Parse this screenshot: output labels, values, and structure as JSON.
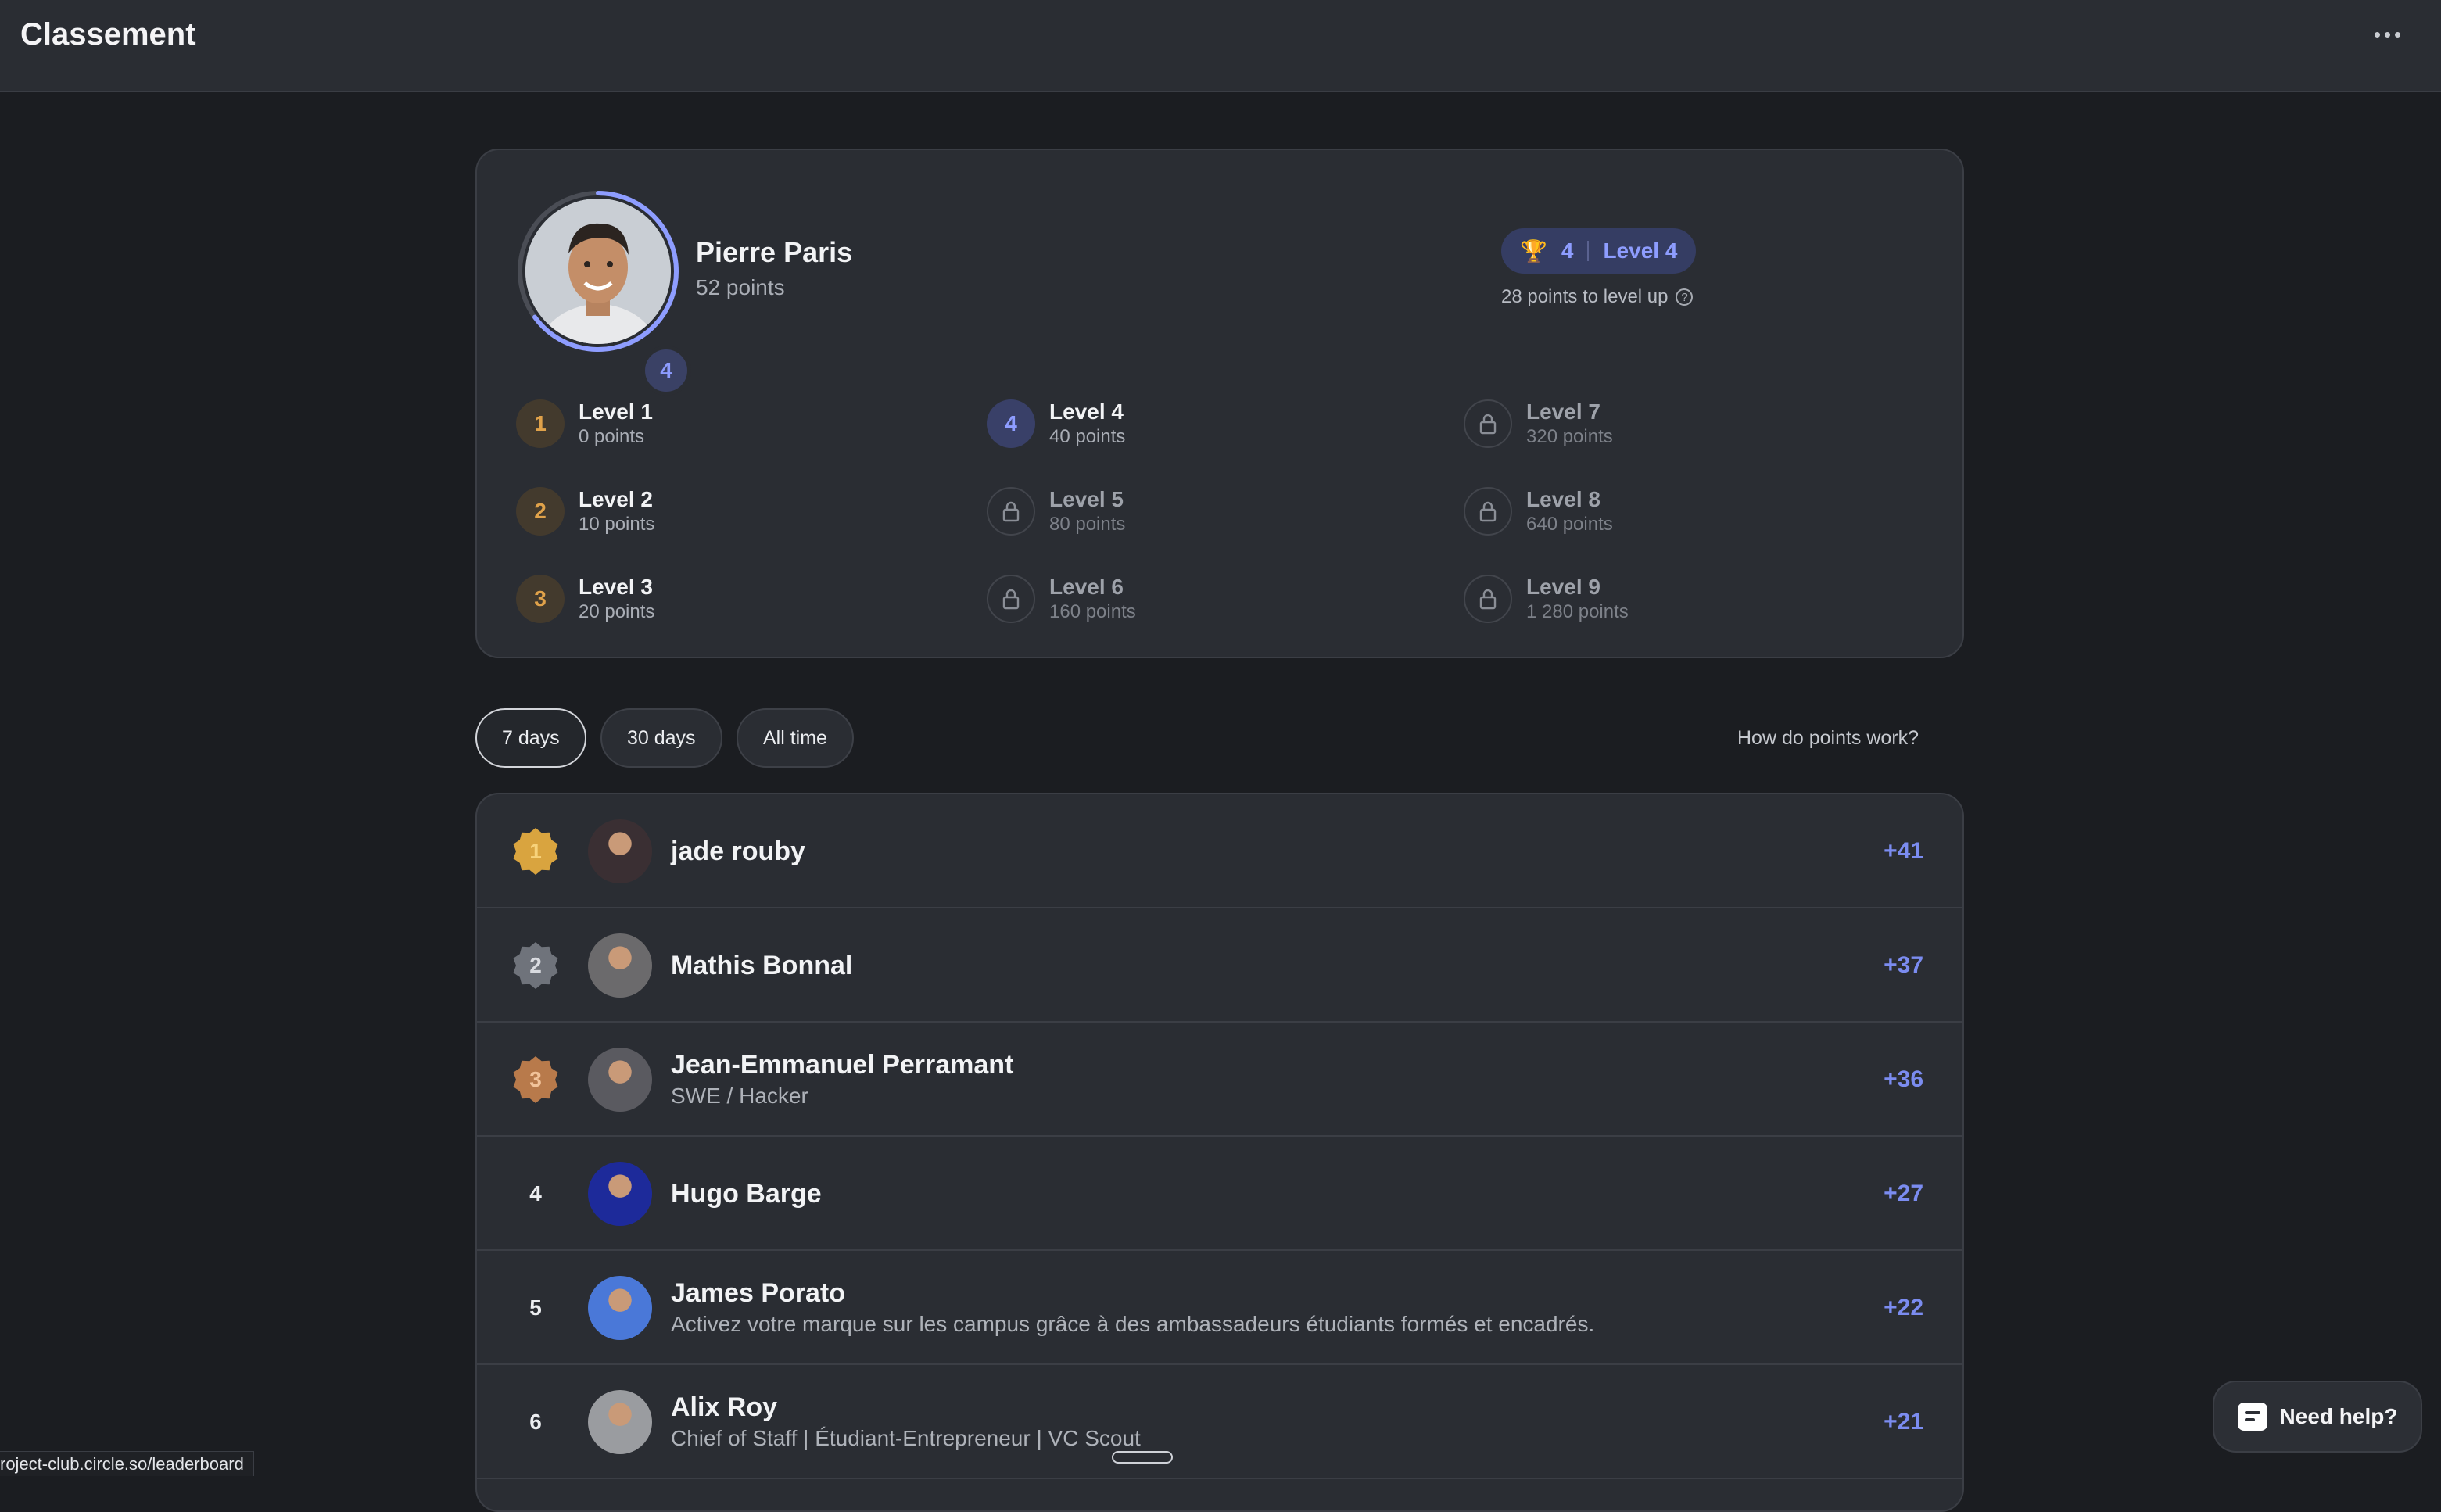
{
  "header": {
    "title": "Classement",
    "menu_icon": "more-horizontal-icon"
  },
  "profile": {
    "name": "Pierre Paris",
    "points": "52 points",
    "level_badge": "4",
    "level_progress": 0.65,
    "pill_count": "4",
    "pill_level": "Level 4",
    "to_level_up": "28 points to level up",
    "accent": "#8e9dff"
  },
  "levels": [
    {
      "badge": "1",
      "name": "Level 1",
      "points": "0 points",
      "state": "done"
    },
    {
      "badge": "2",
      "name": "Level 2",
      "points": "10 points",
      "state": "done"
    },
    {
      "badge": "3",
      "name": "Level 3",
      "points": "20 points",
      "state": "done"
    },
    {
      "badge": "4",
      "name": "Level 4",
      "points": "40 points",
      "state": "current"
    },
    {
      "badge": "lock-icon",
      "name": "Level 5",
      "points": "80 points",
      "state": "locked"
    },
    {
      "badge": "lock-icon",
      "name": "Level 6",
      "points": "160 points",
      "state": "locked"
    },
    {
      "badge": "lock-icon",
      "name": "Level 7",
      "points": "320 points",
      "state": "locked"
    },
    {
      "badge": "lock-icon",
      "name": "Level 8",
      "points": "640 points",
      "state": "locked"
    },
    {
      "badge": "lock-icon",
      "name": "Level 9",
      "points": "1 280 points",
      "state": "locked"
    }
  ],
  "filters": [
    {
      "label": "7 days",
      "active": true
    },
    {
      "label": "30 days",
      "active": false
    },
    {
      "label": "All time",
      "active": false
    }
  ],
  "how_points": "How do points work?",
  "leaderboard": [
    {
      "rank": "1",
      "name": "jade rouby",
      "subtitle": "",
      "score": "+41",
      "medal": "gold"
    },
    {
      "rank": "2",
      "name": "Mathis Bonnal",
      "subtitle": "",
      "score": "+37",
      "medal": "silver"
    },
    {
      "rank": "3",
      "name": "Jean-Emmanuel Perramant",
      "subtitle": "SWE / Hacker",
      "score": "+36",
      "medal": "bronze"
    },
    {
      "rank": "4",
      "name": "Hugo Barge",
      "subtitle": "",
      "score": "+27",
      "medal": ""
    },
    {
      "rank": "5",
      "name": "James Porato",
      "subtitle": "Activez votre marque sur les campus grâce à des ambassadeurs étudiants formés et encadrés.",
      "score": "+22",
      "medal": ""
    },
    {
      "rank": "6",
      "name": "Alix Roy",
      "subtitle": "Chief of Staff | Étudiant-Entrepreneur | VC Scout",
      "score": "+21",
      "medal": ""
    }
  ],
  "help_button": "Need help?",
  "status_url": "roject-club.circle.so/leaderboard",
  "colors": {
    "medal_gold": "#d9a43f",
    "medal_silver": "#6f737b",
    "medal_bronze": "#b87a4b",
    "score": "#7b8cf0"
  }
}
